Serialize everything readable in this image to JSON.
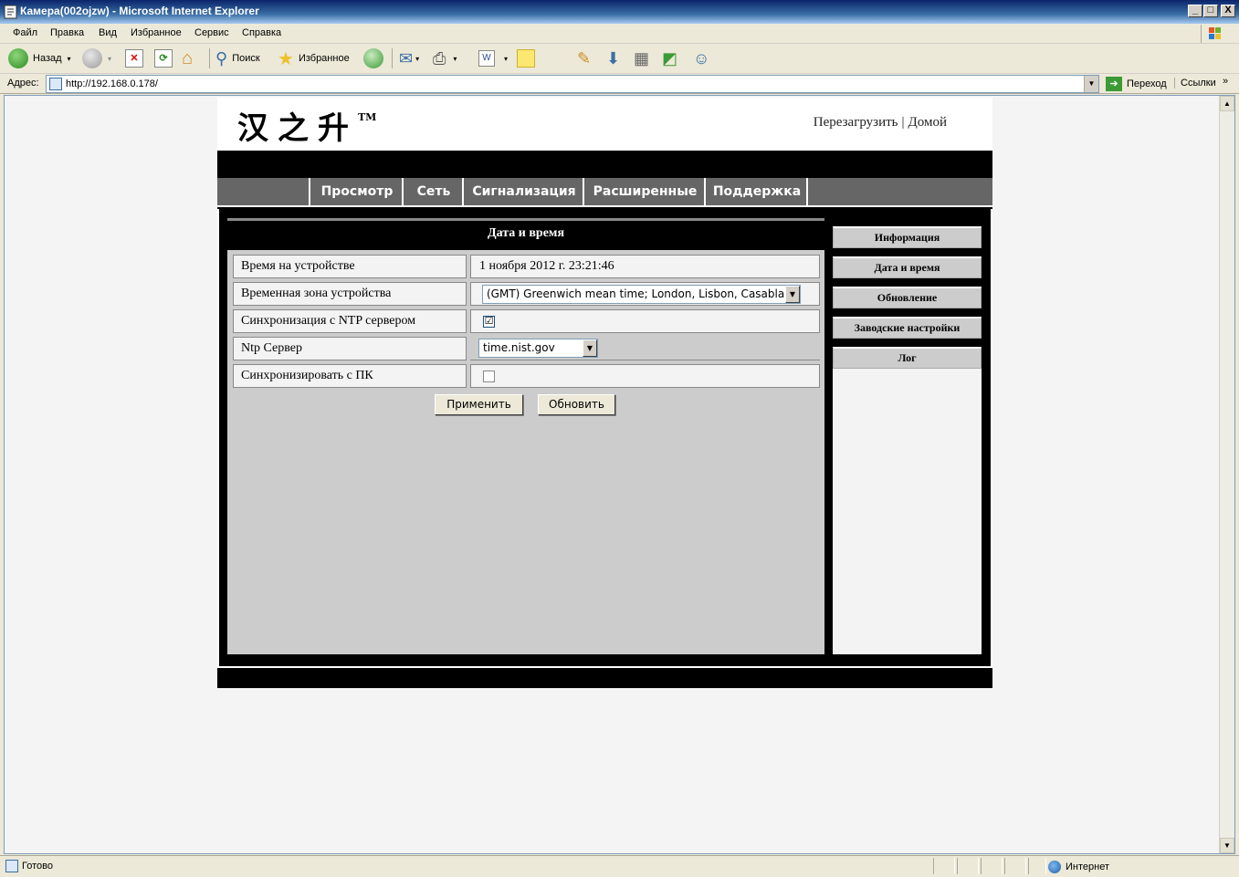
{
  "window": {
    "title": "Камера(002ojzw) - Microsoft Internet Explorer",
    "controls": {
      "minimize": "_",
      "maximize": "□",
      "close": "X"
    }
  },
  "menu": [
    "Файл",
    "Правка",
    "Вид",
    "Избранное",
    "Сервис",
    "Справка"
  ],
  "toolbar": {
    "back_label": "Назад",
    "search_label": "Поиск",
    "favorites_label": "Избранное"
  },
  "address": {
    "label": "Адрес:",
    "url": "http://192.168.0.178/",
    "go_label": "Переход",
    "links_label": "Ссылки"
  },
  "page": {
    "logo_text": "汉之升",
    "logo_tm": "TM",
    "top_links": {
      "reboot": "Перезагрузить",
      "separator": "|",
      "home": "Домой"
    },
    "nav": [
      "Просмотр",
      "Сеть",
      "Сигнализация",
      "Расширенные",
      "Поддержка"
    ],
    "section_title": "Дата и время",
    "rows": [
      {
        "label": "Время на устройстве",
        "value": "1 ноября 2012 г.  23:21:46"
      },
      {
        "label": "Временная зона устройства",
        "value": "(GMT) Greenwich mean time; London, Lisbon, Casablanca"
      },
      {
        "label": "Синхронизация с NTP сервером",
        "value": "☑"
      },
      {
        "label": "Ntp Сервер",
        "value": "time.nist.gov"
      },
      {
        "label": "Синхронизировать с ПК",
        "value": ""
      }
    ],
    "ntp_sync_checked": true,
    "pc_sync_checked": false,
    "buttons": {
      "apply": "Применить",
      "refresh": "Обновить"
    },
    "sidebar": [
      "Информация",
      "Дата и время",
      "Обновление",
      "Заводские настройки",
      "Лог"
    ]
  },
  "status": {
    "text": "Готово",
    "zone": "Интернет"
  },
  "colors": {
    "nav_bg": "#666666",
    "panel_bg": "#cccccc",
    "page_bg": "#000000"
  }
}
